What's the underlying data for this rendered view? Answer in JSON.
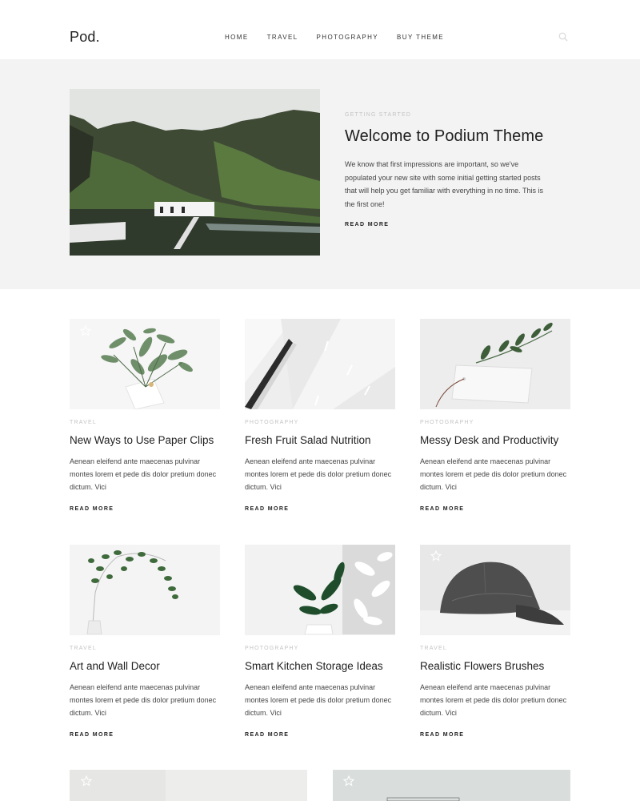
{
  "header": {
    "logo": "Pod.",
    "nav": [
      "HOME",
      "TRAVEL",
      "PHOTOGRAPHY",
      "BUY THEME"
    ]
  },
  "hero": {
    "category": "GETTING STARTED",
    "title": "Welcome to Podium Theme",
    "text": "We know that first impressions are important, so we've populated your new site with some initial getting started posts that will help you get familiar with everything in no time. This is the first one!",
    "read_more": "READ MORE"
  },
  "posts": [
    {
      "category": "TRAVEL",
      "title": "New Ways to Use Paper Clips",
      "excerpt": "Aenean eleifend ante maecenas pulvinar montes lorem et pede dis dolor  pretium donec dictum. Vici",
      "read_more": "READ MORE"
    },
    {
      "category": "PHOTOGRAPHY",
      "title": "Fresh Fruit Salad Nutrition",
      "excerpt": "Aenean eleifend ante maecenas pulvinar montes lorem et pede dis dolor  pretium donec dictum. Vici",
      "read_more": "READ MORE"
    },
    {
      "category": "PHOTOGRAPHY",
      "title": "Messy Desk and Productivity",
      "excerpt": "Aenean eleifend ante maecenas pulvinar montes lorem et pede dis dolor  pretium donec dictum. Vici",
      "read_more": "READ MORE"
    },
    {
      "category": "TRAVEL",
      "title": "Art and Wall Decor",
      "excerpt": "Aenean eleifend ante maecenas pulvinar montes lorem et pede dis dolor  pretium donec dictum. Vici",
      "read_more": "READ MORE"
    },
    {
      "category": "PHOTOGRAPHY",
      "title": "Smart Kitchen Storage Ideas",
      "excerpt": "Aenean eleifend ante maecenas pulvinar montes lorem et pede dis dolor  pretium donec dictum. Vici",
      "read_more": "READ MORE"
    },
    {
      "category": "TRAVEL",
      "title": "Realistic Flowers Brushes",
      "excerpt": "Aenean eleifend ante maecenas pulvinar montes lorem et pede dis dolor  pretium donec dictum. Vici",
      "read_more": "READ MORE"
    }
  ],
  "icons": {
    "search": "search-icon",
    "featured": "star-icon"
  },
  "colors": {
    "hero_bg": "#f3f3f3",
    "meta_text": "#c4c4c4",
    "title_text": "#1f1f1f"
  }
}
